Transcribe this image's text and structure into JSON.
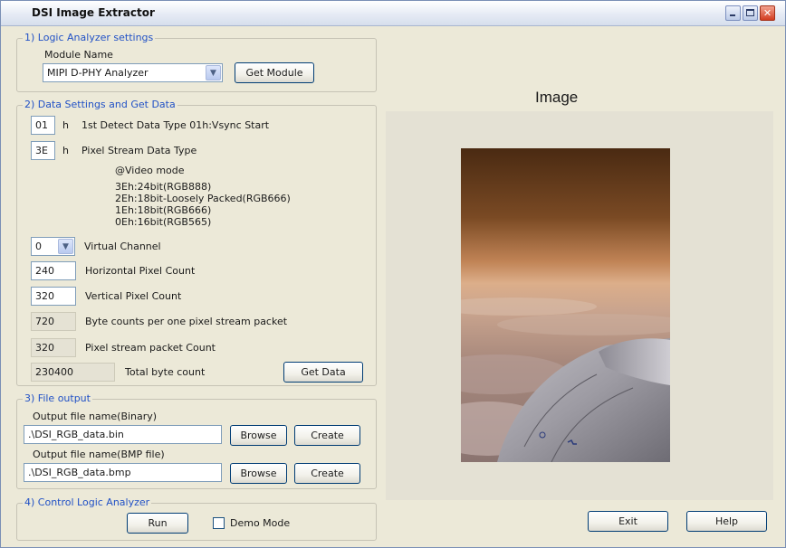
{
  "window": {
    "title": "DSI Image Extractor"
  },
  "logic_settings": {
    "legend": "1) Logic Analyzer settings",
    "module_name_label": "Module Name",
    "module_value": "MIPI D-PHY Analyzer",
    "get_module_label": "Get Module"
  },
  "data_settings": {
    "legend": "2) Data Settings and Get Data",
    "detect_value": "01",
    "detect_unit": "h",
    "detect_label": "1st Detect Data Type 01h:Vsync Start",
    "pixel_type_value": "3E",
    "pixel_type_unit": "h",
    "pixel_type_label": "Pixel Stream Data Type",
    "video_mode_lines": [
      "@Video mode",
      "3Eh:24bit(RGB888)",
      "2Eh:18bit-Loosely Packed(RGB666)",
      "1Eh:18bit(RGB666)",
      "0Eh:16bit(RGB565)"
    ],
    "virtual_channel_value": "0",
    "virtual_channel_label": "Virtual Channel",
    "h_pixel_value": "240",
    "h_pixel_label": "Horizontal Pixel Count",
    "v_pixel_value": "320",
    "v_pixel_label": "Vertical Pixel Count",
    "byte_counts_value": "720",
    "byte_counts_label": "Byte counts per one pixel stream packet",
    "packet_count_value": "320",
    "packet_count_label": "Pixel stream packet Count",
    "total_value": "230400",
    "total_label": "Total byte count",
    "get_data_label": "Get Data"
  },
  "file_output": {
    "legend": "3) File output",
    "binary_label": "Output file name(Binary)",
    "binary_value": ".\\DSI_RGB_data.bin",
    "bmp_label": "Output file name(BMP file)",
    "bmp_value": ".\\DSI_RGB_data.bmp",
    "browse_label": "Browse",
    "create_label": "Create"
  },
  "control": {
    "legend": "4) Control Logic Analyzer",
    "run_label": "Run",
    "demo_label": "Demo Mode",
    "demo_checked": false
  },
  "image": {
    "title": "Image"
  },
  "footer": {
    "exit_label": "Exit",
    "help_label": "Help"
  },
  "colors": {
    "accent": "#2151c6",
    "window_bg": "#ece9d8",
    "panel_bg": "#e4e1d4"
  },
  "icons": {
    "minimize": "minimize-icon",
    "maximize": "maximize-icon",
    "close": "close-icon",
    "dropdown": "chevron-down-icon"
  }
}
